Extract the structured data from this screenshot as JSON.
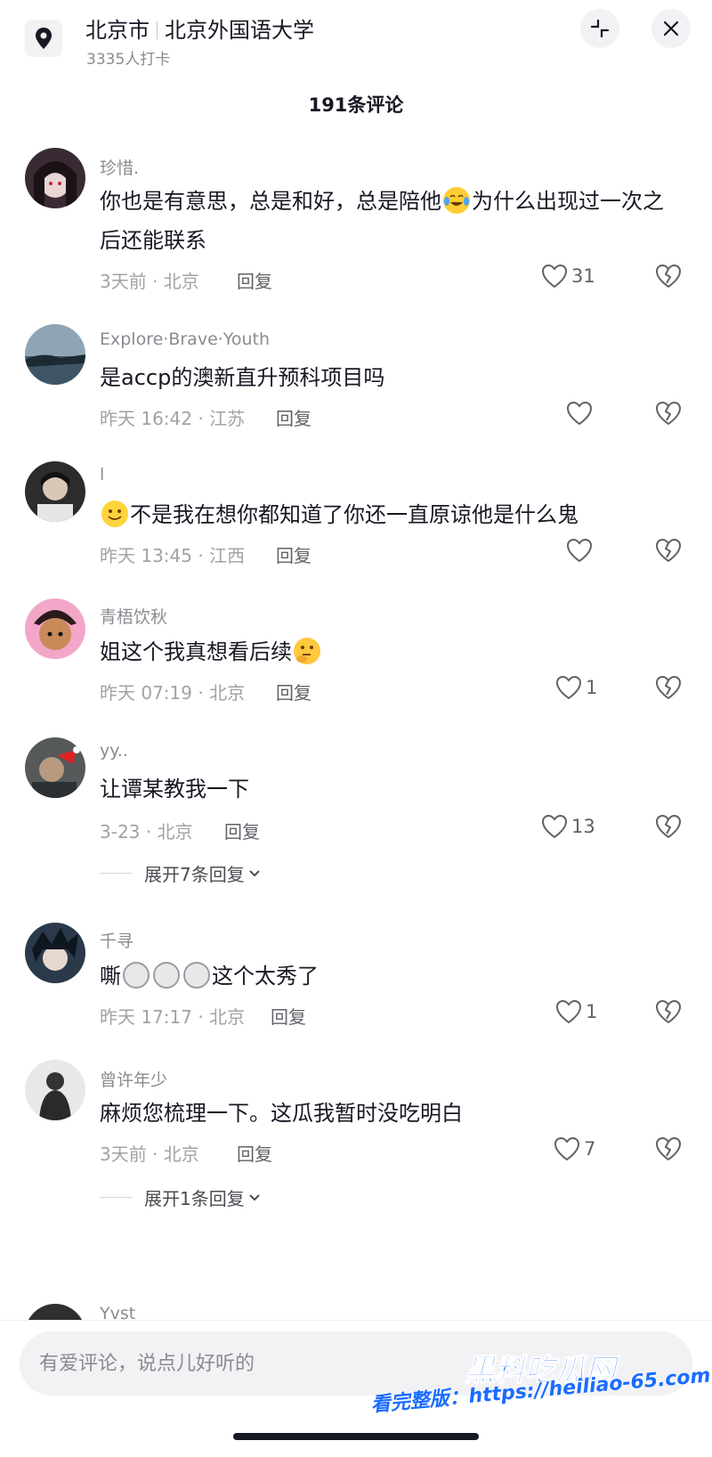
{
  "header": {
    "city": "北京市",
    "place": "北京外国语大学",
    "checkins": "3335人打卡"
  },
  "comments_title": "191条评论",
  "comments": [
    {
      "user": "珍惜.",
      "text_parts": [
        "你也是有意思，总是和好，总是陪他",
        "为什么出现过一次之后还能联系"
      ],
      "emoji": "crying-laughing-emoji",
      "meta": "3天前 · 北京",
      "reply": "回复",
      "likes": "31"
    },
    {
      "user": "Explore·Brave·Youth",
      "text": "是accp的澳新直升预科项目吗",
      "meta": "昨天 16:42 · 江苏",
      "reply": "回复",
      "likes": ""
    },
    {
      "user": "l",
      "text": "不是我在想你都知道了你还一直原谅他是什么鬼",
      "emoji": "smile-emoji",
      "meta": "昨天 13:45 · 江西",
      "reply": "回复",
      "likes": ""
    },
    {
      "user": "青梧饮秋",
      "text": "姐这个我真想看后续",
      "emoji": "thinking-emoji",
      "meta": "昨天 07:19 · 北京",
      "reply": "回复",
      "likes": "1"
    },
    {
      "user": "yy..",
      "text": "让谭某教我一下",
      "meta": "3-23 · 北京",
      "reply": "回复",
      "likes": "13",
      "expand": "展开7条回复"
    },
    {
      "user": "千寻",
      "text_parts": [
        "嘶",
        "这个太秀了"
      ],
      "emoji": "shocked-emoji",
      "meta": "昨天 17:17 · 北京",
      "reply": "回复",
      "likes": "1"
    },
    {
      "user": "曾许年少",
      "text": "麻烦您梳理一下。这瓜我暂时没吃明白",
      "meta": "3天前 · 北京",
      "reply": "回复",
      "likes": "7",
      "expand": "展开1条回复"
    },
    {
      "user": "Yvst"
    }
  ],
  "input": {
    "placeholder": "有爱评论，说点儿好听的"
  },
  "watermark": {
    "brand": "黑料吃瓜网",
    "url": "看完整版：https://heiliao-65.com"
  },
  "colors": {
    "text": "#161823",
    "muted": "#8a8b91",
    "watermark": "#1a6cff"
  }
}
